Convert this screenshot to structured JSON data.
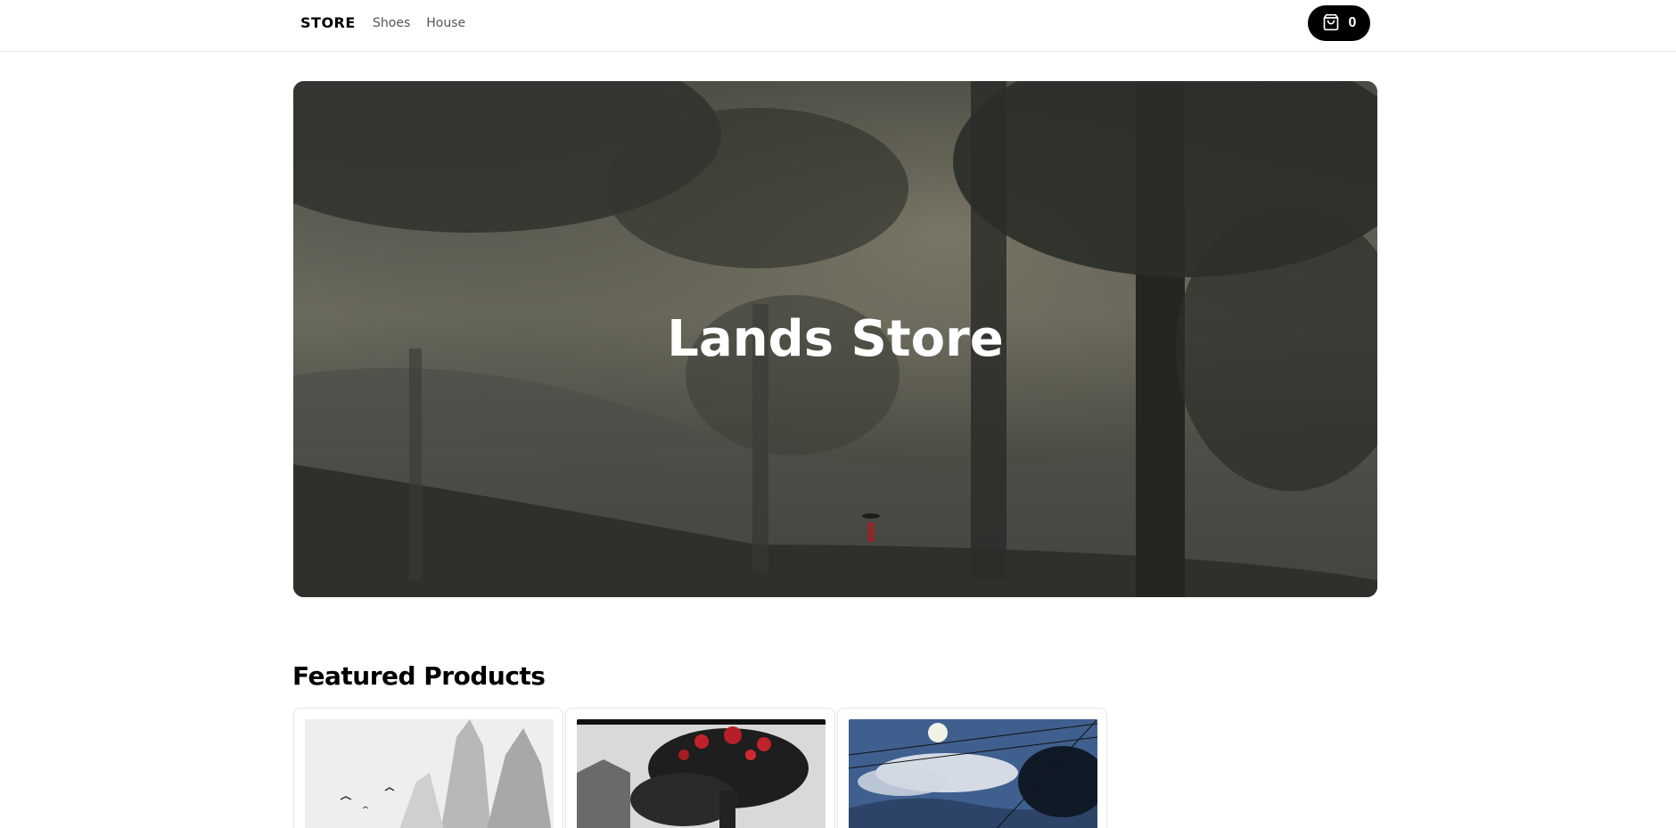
{
  "nav": {
    "brand": "STORE",
    "links": [
      "Shoes",
      "House"
    ],
    "cart_count": "0",
    "cart_icon": "shopping-bag-icon"
  },
  "hero": {
    "title": "Lands Store"
  },
  "featured": {
    "title": "Featured Products",
    "products": [
      {
        "image": "misty-mountains-birds-painting"
      },
      {
        "image": "red-blossom-tree-pagoda-painting"
      },
      {
        "image": "moonlit-night-power-lines-painting"
      }
    ]
  },
  "colors": {
    "background": "#ffffff",
    "accent": "#000000",
    "hero_text": "#ffffff"
  }
}
